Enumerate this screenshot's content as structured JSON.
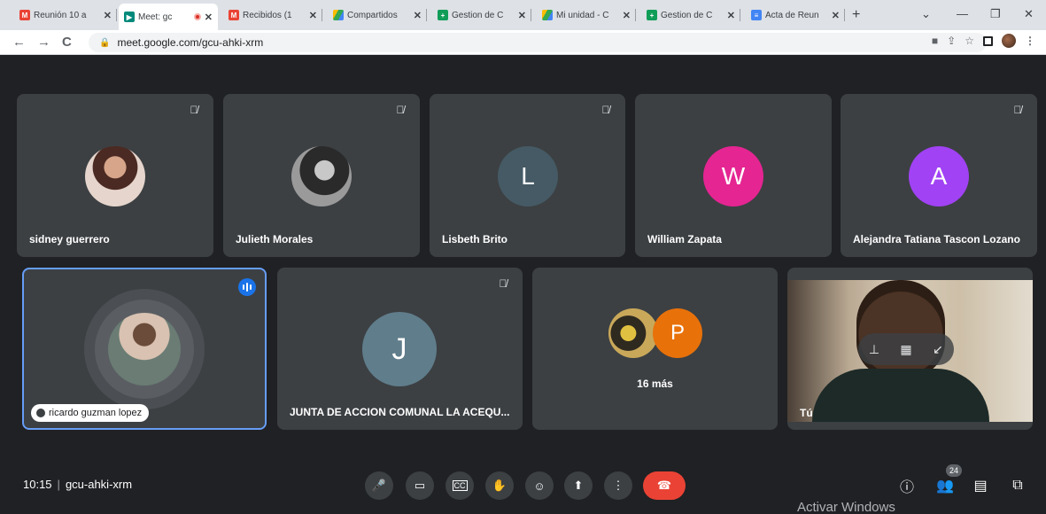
{
  "browser": {
    "tabs": [
      {
        "title": "Reunión 10 a",
        "favicon": "gmail-icon",
        "active": false
      },
      {
        "title": "Meet: gc",
        "favicon": "meet-icon",
        "active": true,
        "recording": true
      },
      {
        "title": "Recibidos (1",
        "favicon": "gmail-icon",
        "active": false
      },
      {
        "title": "Compartidos",
        "favicon": "drive-icon",
        "active": false
      },
      {
        "title": "Gestion de C",
        "favicon": "sheets-icon",
        "active": false
      },
      {
        "title": "Mi unidad - C",
        "favicon": "drive-icon",
        "active": false
      },
      {
        "title": "Gestion de C",
        "favicon": "sheets-icon",
        "active": false
      },
      {
        "title": "Acta de Reun",
        "favicon": "docs-icon",
        "active": false
      }
    ],
    "new_tab": "+",
    "url": "meet.google.com/gcu-ahki-xrm"
  },
  "participants": [
    {
      "name": "sidney guerrero",
      "muted": true,
      "avatar": "photo"
    },
    {
      "name": "Julieth Morales",
      "muted": true,
      "avatar": "photo"
    },
    {
      "name": "Lisbeth Brito",
      "muted": true,
      "initial": "L",
      "color": "#455a64"
    },
    {
      "name": "William Zapata",
      "muted": false,
      "initial": "W",
      "color": "#e52592"
    },
    {
      "name": "Alejandra Tatiana Tascon Lozano",
      "muted": true,
      "initial": "A",
      "color": "#a142f4"
    },
    {
      "name": "ricardo guzman lopez",
      "speaking": true,
      "avatar": "photo"
    },
    {
      "name": "JUNTA DE ACCION COMUNAL LA ACEQU...",
      "muted": true,
      "initial": "J",
      "color": "#607d8b"
    }
  ],
  "others": {
    "initial": "P",
    "color": "#e8710a",
    "label": "16 más"
  },
  "self": {
    "name": "Tú"
  },
  "meeting": {
    "time": "10:15",
    "code": "gcu-ahki-xrm"
  },
  "people_count": "24",
  "watermark": "Activar Windows",
  "colors": {
    "accent": "#1a73e8",
    "end_call": "#ea4335",
    "tile": "#3c4043",
    "background": "#202124"
  }
}
